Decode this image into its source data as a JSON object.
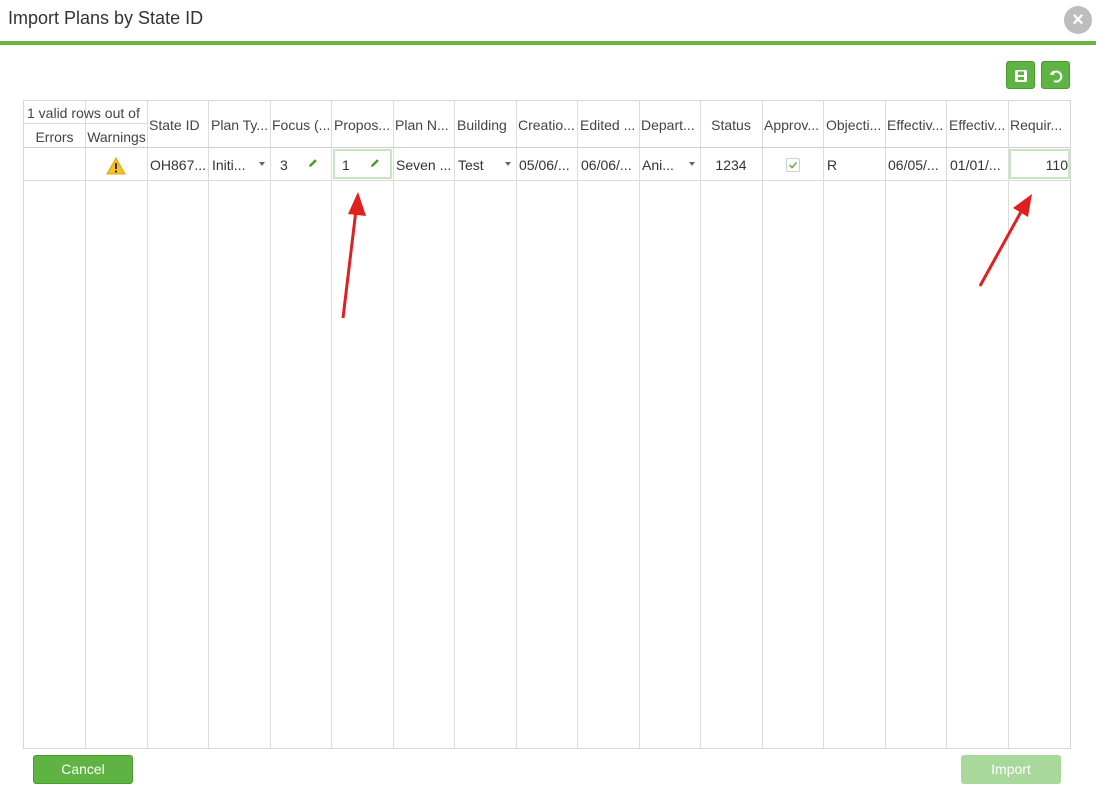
{
  "dialog": {
    "title": "Import Plans by State ID"
  },
  "toolbar": {
    "save_icon": "save-icon",
    "undo_icon": "undo-icon"
  },
  "grid": {
    "group_header": "1 valid rows out of",
    "columns": [
      "Errors",
      "Warnings",
      "State ID",
      "Plan Ty...",
      "Focus (...",
      "Propos...",
      "Plan N...",
      "Building",
      "Creatio...",
      "Edited ...",
      "Depart...",
      "Status",
      "Approv...",
      "Objecti...",
      "Effectiv...",
      "Effectiv...",
      "Requir..."
    ],
    "row": {
      "errors": "",
      "warning_icon": "warning-icon",
      "state_id": "OH867...",
      "plan_type": "Initi...",
      "focus": "3",
      "proposed": "1",
      "plan_name": "Seven ...",
      "building": "Test",
      "creation": "05/06/...",
      "edited": "06/06/...",
      "department": "Ani...",
      "status": "1234",
      "approved": true,
      "objective": "R",
      "effective_start": "06/05/...",
      "effective_end": "01/01/...",
      "required": "110"
    }
  },
  "footer": {
    "cancel_label": "Cancel",
    "import_label": "Import"
  },
  "colors": {
    "accent": "#5fb342",
    "accent_disabled": "#a8d89a",
    "annotation_arrow": "#e02020"
  }
}
